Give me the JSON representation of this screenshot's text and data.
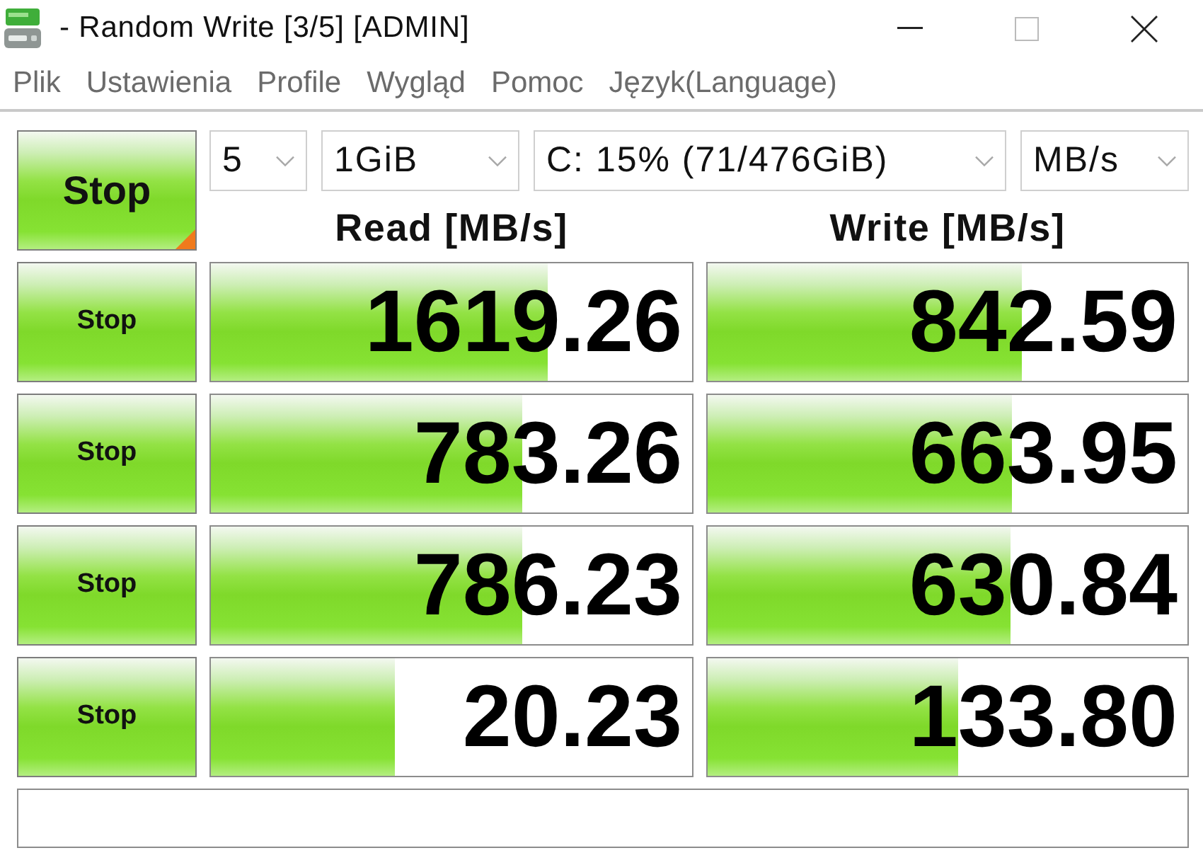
{
  "window": {
    "title": "- Random Write [3/5] [ADMIN]"
  },
  "menu": [
    "Plik",
    "Ustawienia",
    "Profile",
    "Wygląd",
    "Pomoc",
    "Język(Language)"
  ],
  "toolbar": {
    "all_button": "Stop",
    "count": "5",
    "size": "1GiB",
    "drive": "C: 15% (71/476GiB)",
    "unit": "MB/s"
  },
  "headers": {
    "read": "Read [MB/s]",
    "write": "Write [MB/s]"
  },
  "rows": [
    {
      "button": "Stop",
      "read": {
        "value": "1619.26",
        "level": 0.7
      },
      "write": {
        "value": "842.59",
        "level": 0.655
      }
    },
    {
      "button": "Stop",
      "read": {
        "value": "783.26",
        "level": 0.646
      },
      "write": {
        "value": "663.95",
        "level": 0.635
      }
    },
    {
      "button": "Stop",
      "read": {
        "value": "786.23",
        "level": 0.646
      },
      "write": {
        "value": "630.84",
        "level": 0.63
      }
    },
    {
      "button": "Stop",
      "read": {
        "value": "20.23",
        "level": 0.383
      },
      "write": {
        "value": "133.80",
        "level": 0.522
      }
    }
  ]
}
